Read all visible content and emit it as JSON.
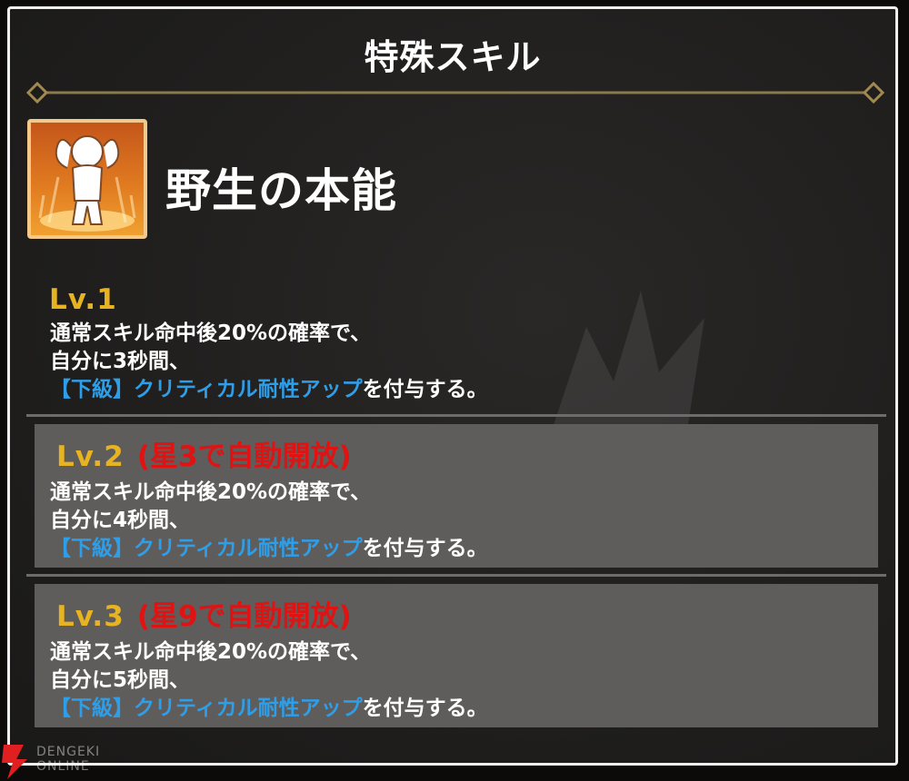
{
  "dialog": {
    "title": "特殊スキル"
  },
  "skill": {
    "name": "野生の本能",
    "icon": "flexing-figure-icon"
  },
  "levels": [
    {
      "label": "Lv.1",
      "unlock": "",
      "line1": "通常スキル命中後20%の確率で、",
      "line2": "自分に3秒間、",
      "buff": "【下級】クリティカル耐性アップ",
      "suffix": "を付与する。"
    },
    {
      "label": "Lv.2",
      "unlock": "(星3で自動開放)",
      "line1": "通常スキル命中後20%の確率で、",
      "line2": "自分に4秒間、",
      "buff": "【下級】クリティカル耐性アップ",
      "suffix": "を付与する。"
    },
    {
      "label": "Lv.3",
      "unlock": "(星9で自動開放)",
      "line1": "通常スキル命中後20%の確率で、",
      "line2": "自分に5秒間、",
      "buff": "【下級】クリティカル耐性アップ",
      "suffix": "を付与する。"
    }
  ],
  "watermark": {
    "line1": "DENGEKI",
    "line2": "ONLINE"
  },
  "colors": {
    "level_label": "#e8b321",
    "unlock_text": "#e01212",
    "buff_text": "#2f9ee8",
    "locked_bg": "#5f5d5c",
    "panel_border": "#efefef"
  }
}
